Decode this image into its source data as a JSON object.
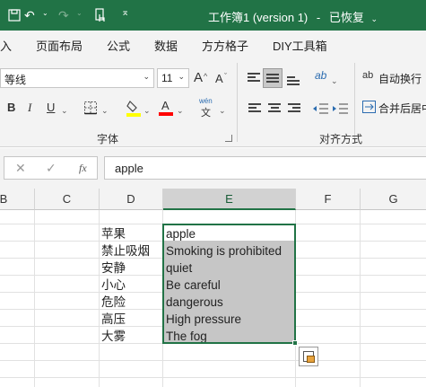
{
  "titlebar": {
    "title": "工作簿1 (version 1)",
    "separator": "-",
    "status": "已恢复",
    "chevron": "⌄",
    "icons": [
      "save-icon",
      "undo-icon",
      "redo-icon",
      "touch-mode-icon",
      "customize-qat-icon"
    ],
    "undo_glyph": "↶",
    "redo_glyph": "↷",
    "caret_glyph": "⌄",
    "qat_glyph": "⌅",
    "colors": {
      "titlebar_bg": "#217346"
    }
  },
  "tabs": [
    "入",
    "页面布局",
    "公式",
    "数据",
    "方方格子",
    "DIY工具箱"
  ],
  "ribbon": {
    "font_group": {
      "label": "字体",
      "font_name": "等线",
      "font_size": "11",
      "grow_font": "A",
      "shrink_font": "A",
      "bold": "B",
      "italic": "I",
      "underline": "U",
      "wen_top": "wén",
      "wen_bottom": "文",
      "font_color_letter": "A",
      "colors": {
        "highlight": "#ffff00",
        "font": "#ff0000"
      }
    },
    "align_group": {
      "label": "对齐方式",
      "wrap_text": "自动换行",
      "merge_center": "合并后居中",
      "wrap_icon": "ab",
      "orient_icon": "ab"
    },
    "dropdown_glyph": "⌄"
  },
  "formula_bar": {
    "cancel_glyph": "✕",
    "confirm_glyph": "✓",
    "fx": "fx",
    "value": "apple"
  },
  "sheet": {
    "columns": [
      "B",
      "C",
      "D",
      "E",
      "F",
      "G"
    ],
    "selected_column": "E",
    "column_d": [
      "苹果",
      "禁止吸烟",
      "安静",
      "小心",
      "危险",
      "高压",
      "大雾"
    ],
    "column_e": [
      "apple",
      "Smoking is prohibited",
      "quiet",
      "Be careful",
      "dangerous",
      "High pressure",
      "The fog"
    ],
    "colors": {
      "selection_border": "#217346",
      "selection_fill": "#c6c6c6"
    }
  }
}
